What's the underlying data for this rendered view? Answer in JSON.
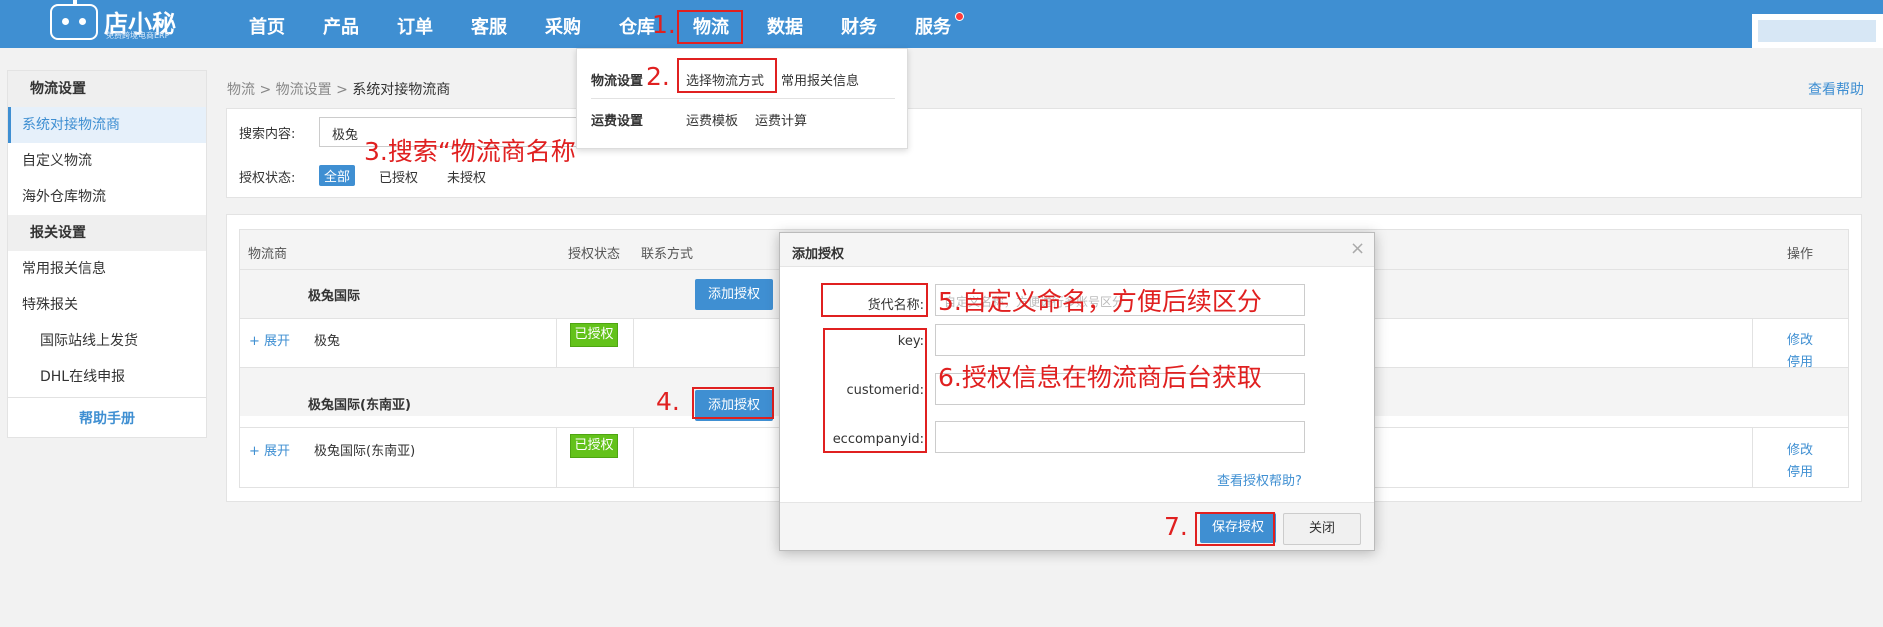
{
  "app": {
    "logo_text": "店小秘",
    "logo_sub": "免费跨境电商ERP"
  },
  "nav": {
    "items": [
      "首页",
      "产品",
      "订单",
      "客服",
      "采购",
      "仓库",
      "物流",
      "数据",
      "财务",
      "服务"
    ]
  },
  "dropdown": {
    "group1_title": "物流设置",
    "group1_items": [
      "选择物流方式",
      "常用报关信息"
    ],
    "group2_title": "运费设置",
    "group2_items": [
      "运费模板",
      "运费计算"
    ]
  },
  "sidebar": {
    "section1": "物流设置",
    "section1_items": [
      "系统对接物流商",
      "自定义物流",
      "海外仓库物流"
    ],
    "section2": "报关设置",
    "section2_items": [
      "常用报关信息",
      "特殊报关"
    ],
    "sub_items": [
      "国际站线上发货",
      "DHL在线申报"
    ],
    "help": "帮助手册"
  },
  "breadcrumb": {
    "items": [
      "物流",
      "物流设置",
      "系统对接物流商"
    ],
    "sep": ">"
  },
  "help_link": "查看帮助",
  "filter": {
    "search_label": "搜索内容:",
    "search_value": "极兔",
    "status_label": "授权状态:",
    "status_options": [
      "全部",
      "已授权",
      "未授权"
    ]
  },
  "table": {
    "headers": [
      "物流商",
      "授权状态",
      "联系方式",
      "操作"
    ],
    "groups": [
      {
        "name": "极兔国际",
        "add_button": "添加授权",
        "expand": "+ 展开",
        "item": "极兔",
        "status": "已授权",
        "actions": [
          "修改",
          "停用"
        ]
      },
      {
        "name": "极兔国际(东南亚)",
        "add_button": "添加授权",
        "expand": "+ 展开",
        "item": "极兔国际(东南亚)",
        "status": "已授权",
        "actions": [
          "修改",
          "停用"
        ]
      }
    ]
  },
  "modal": {
    "title": "添加授权",
    "close_icon": "×",
    "fields": [
      {
        "label": "货代名称:",
        "placeholder": "自定义名称，方便进行多账号区分"
      },
      {
        "label": "key:",
        "placeholder": ""
      },
      {
        "label": "customerid:",
        "placeholder": ""
      },
      {
        "label": "eccompanyid:",
        "placeholder": ""
      }
    ],
    "help_link": "查看授权帮助?",
    "save_button": "保存授权",
    "close_button": "关闭"
  },
  "annotations": {
    "step1": "1.",
    "step2": "2.",
    "step3": "3.搜索“物流商名称”",
    "step4": "4.",
    "step5": "5.自定义命名，方便后续区分",
    "step6": "6.授权信息在物流商后台获取",
    "step7": "7."
  },
  "colors": {
    "primary": "#3f8fd2",
    "annotation_red": "#e02020",
    "authorized_green": "#63c21a"
  }
}
